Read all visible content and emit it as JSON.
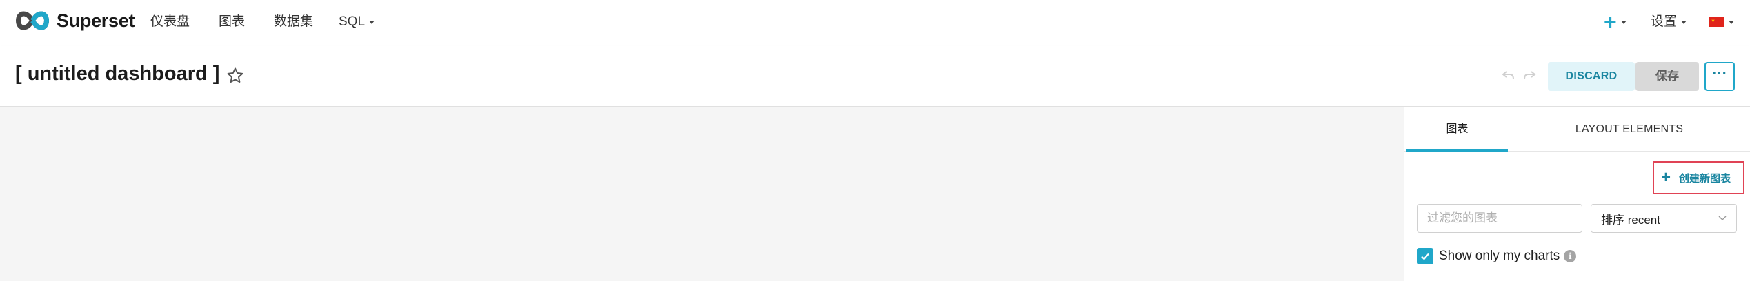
{
  "nav": {
    "brand": "Superset",
    "items": [
      {
        "label": "仪表盘"
      },
      {
        "label": "图表"
      },
      {
        "label": "数据集"
      },
      {
        "label": "SQL"
      }
    ],
    "plus_icon": "plus-icon",
    "settings_label": "设置",
    "language_icon": "china-flag-icon",
    "accent_color": "#20a7c9"
  },
  "header": {
    "title": "[ untitled dashboard ]",
    "discard_label": "DISCARD",
    "save_label": "保存",
    "more_label": "···"
  },
  "panel": {
    "tabs": [
      {
        "label": "图表"
      },
      {
        "label": "LAYOUT ELEMENTS"
      }
    ],
    "create_chart_label": "创建新图表",
    "filter_placeholder": "过滤您的图表",
    "sort_label": "排序 recent",
    "show_only_mine_label": "Show only my charts",
    "show_only_mine_checked": true
  }
}
